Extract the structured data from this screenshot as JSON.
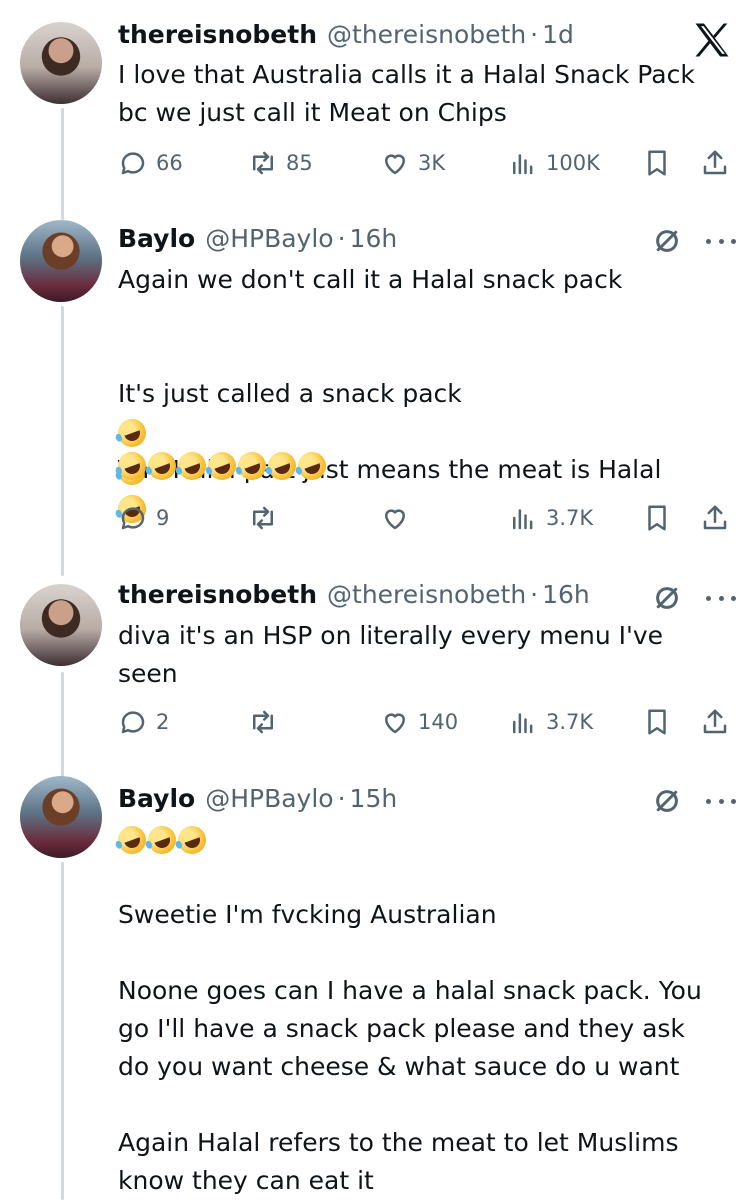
{
  "tweets": [
    {
      "name": "thereisnobeth",
      "handle": "@thereisnobeth",
      "time": "1d",
      "text": "I love that Australia calls it a Halal Snack Pack\nbc we just call it Meat on Chips",
      "replies": "66",
      "reposts": "85",
      "likes": "3K",
      "views": "100K"
    },
    {
      "name": "Baylo",
      "handle": "@HPBaylo",
      "time": "16h",
      "text_line1": "Again we don't call it a Halal snack pack",
      "text_line2": "It's just called a snack pack",
      "text_line3": "The Halal part just means the meat is Halal",
      "replies": "9",
      "reposts": "",
      "likes": "",
      "views": "3.7K"
    },
    {
      "name": "thereisnobeth",
      "handle": "@thereisnobeth",
      "time": "16h",
      "text": "diva it's an HSP on literally every menu I've\nseen",
      "replies": "2",
      "reposts": "",
      "likes": "140",
      "views": "3.7K"
    },
    {
      "name": "Baylo",
      "handle": "@HPBaylo",
      "time": "15h",
      "text_p1": "Sweetie I'm fvcking Australian",
      "text_p2": "Noone goes can I have a halal snack pack. You\ngo I'll have a snack pack please and they ask\ndo you want cheese & what sauce do u want",
      "text_p3": "Again Halal refers to the meat to let Muslims\nknow they can eat it"
    }
  ],
  "dot": "·",
  "icons": {
    "reply": "speech-bubble-icon",
    "repost": "repost-arrows-icon",
    "like": "heart-icon",
    "views": "bar-chart-icon",
    "bookmark": "bookmark-icon",
    "share": "share-upload-icon",
    "grok": "grok-slash-circle-icon",
    "more": "more-dots-icon",
    "logo": "x-logo-icon",
    "emoji": "rolling-on-floor-laughing-emoji"
  },
  "colors": {
    "text": "#0f1419",
    "secondary": "#536471",
    "thread_line": "#cfd9de"
  }
}
